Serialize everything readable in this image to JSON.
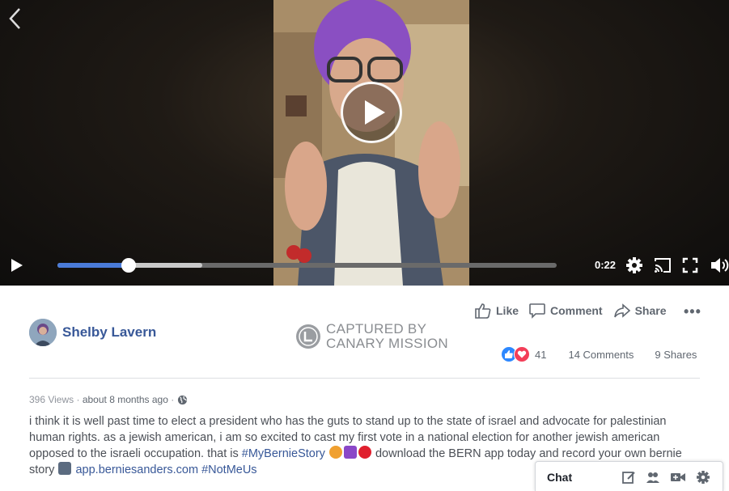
{
  "player": {
    "time": "0:22",
    "progress_fraction": 0.143,
    "buffered_fraction": 0.29
  },
  "author": {
    "name": "Shelby Lavern"
  },
  "watermark": {
    "line1": "CAPTURED BY",
    "line2": "CANARY MISSION"
  },
  "actions": {
    "like": "Like",
    "comment": "Comment",
    "share": "Share",
    "more": "•••"
  },
  "stats": {
    "reactions": "41",
    "comments": "14 Comments",
    "shares": "9 Shares"
  },
  "meta": {
    "views": "396 Views",
    "sep1": " · ",
    "time": "about 8 months ago",
    "sep2": " · "
  },
  "description": {
    "text1": "i think it is well past time to elect a president who has the guts to stand up to the state of israel and advocate for palestinian human rights. as a jewish american, i am so excited to cast my first vote in a national election for another jewish american opposed to the israeli occupation. that is ",
    "hashtag1": "#MyBernieStory",
    "text2": " download the BERN app today and record your own bernie story ",
    "link": "app.berniesanders.com",
    "hashtag2": "#NotMeUs"
  },
  "chat": {
    "label": "Chat"
  },
  "colors": {
    "link": "#385898",
    "progress": "#4a7bd8",
    "like_blue": "#2d88ff",
    "love_red": "#f33e58"
  },
  "icons": [
    "back-chevron-icon",
    "play-icon",
    "settings-gear-icon",
    "cast-icon",
    "fullscreen-icon",
    "volume-icon",
    "like-thumb-icon",
    "comment-bubble-icon",
    "share-arrow-icon",
    "globe-icon",
    "compose-icon",
    "group-icon",
    "video-call-icon"
  ]
}
